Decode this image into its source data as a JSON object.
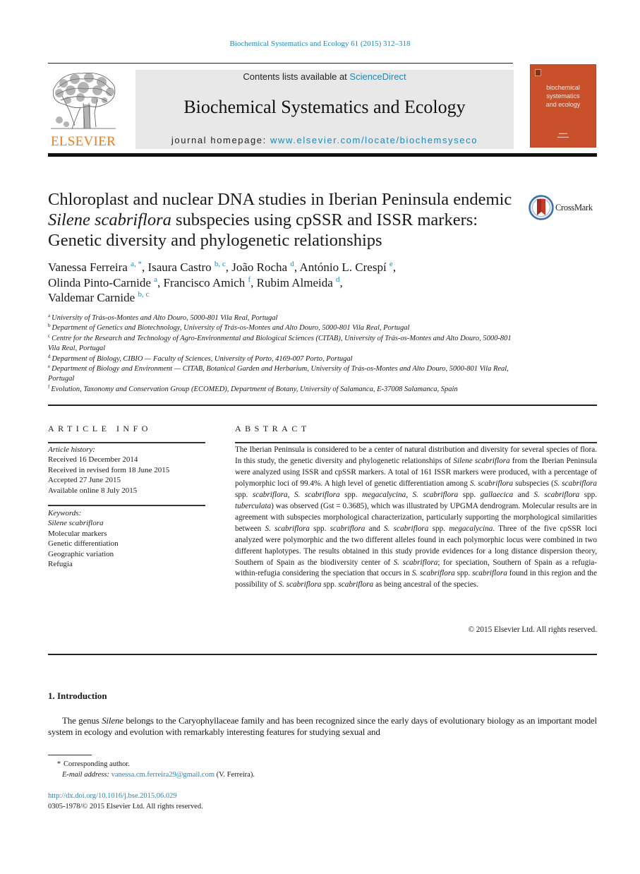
{
  "running_head": "Biochemical Systematics and Ecology 61 (2015) 312–318",
  "publisher": {
    "logo_word": "ELSEVIER",
    "logo_color": "#f07c1a"
  },
  "banner": {
    "contents_prefix": "Contents lists available at ",
    "contents_link": "ScienceDirect",
    "journal_title": "Biochemical Systematics and Ecology",
    "homepage_prefix": "journal homepage: ",
    "homepage_link": "www.elsevier.com/locate/biochemsyseco"
  },
  "cover": {
    "title_line1": "biochemical",
    "title_line2": "systematics",
    "title_line3": "and ecology",
    "color": "#c9502a"
  },
  "crossmark": {
    "label": "CrossMark"
  },
  "article": {
    "title_part1": "Chloroplast and nuclear DNA studies in Iberian Peninsula endemic ",
    "title_italic": "Silene scabriflora",
    "title_part2": " subspecies using cpSSR and ISSR markers: Genetic diversity and phylogenetic relationships"
  },
  "authors": [
    {
      "name": "Vanessa Ferreira",
      "sup": "a, *",
      "sep": ", "
    },
    {
      "name": "Isaura Castro",
      "sup": "b, c",
      "sep": ", "
    },
    {
      "name": "João Rocha",
      "sup": "d",
      "sep": ", "
    },
    {
      "name": "António L. Crespí",
      "sup": "e",
      "sep": ","
    },
    {
      "name": "Olinda Pinto-Carnide",
      "sup": "a",
      "sep": ", "
    },
    {
      "name": "Francisco Amich",
      "sup": "f",
      "sep": ", "
    },
    {
      "name": "Rubim Almeida",
      "sup": "d",
      "sep": ","
    },
    {
      "name": "Valdemar Carnide",
      "sup": "b, c",
      "sep": ""
    }
  ],
  "affiliations": [
    {
      "key": "a",
      "text": "University of Trás-os-Montes and Alto Douro, 5000-801 Vila Real, Portugal"
    },
    {
      "key": "b",
      "text": "Department of Genetics and Biotechnology, University of Trás-os-Montes and Alto Douro, 5000-801 Vila Real, Portugal"
    },
    {
      "key": "c",
      "text": "Centre for the Research and Technology of Agro-Environmental and Biological Sciences (CITAB), University of Trás-os-Montes and Alto Douro, 5000-801 Vila Real, Portugal"
    },
    {
      "key": "d",
      "text": "Department of Biology, CIBIO — Faculty of Sciences, University of Porto, 4169-007 Porto, Portugal"
    },
    {
      "key": "e",
      "text": "Department of Biology and Environment — CITAB, Botanical Garden and Herbarium, University of Trás-os-Montes and Alto Douro, 5000-801 Vila Real, Portugal"
    },
    {
      "key": "f",
      "text": "Evolution, Taxonomy and Conservation Group (ECOMED), Department of Botany, University of Salamanca, E-37008 Salamanca, Spain"
    }
  ],
  "article_info": {
    "heading": "ARTICLE INFO",
    "history_label": "Article history:",
    "history": [
      "Received 16 December 2014",
      "Received in revised form 18 June 2015",
      "Accepted 27 June 2015",
      "Available online 8 July 2015"
    ],
    "keywords_label": "Keywords:",
    "keywords": [
      "Silene scabriflora",
      "Molecular markers",
      "Genetic differentiation",
      "Geographic variation",
      "Refugia"
    ]
  },
  "abstract": {
    "heading": "ABSTRACT",
    "segments": [
      {
        "t": "The Iberian Peninsula is considered to be a center of natural distribution and diversity for several species of flora. In this study, the genetic diversity and phylogenetic relationships of "
      },
      {
        "t": "Silene scabriflora",
        "i": true
      },
      {
        "t": " from the Iberian Peninsula were analyzed using ISSR and cpSSR markers. A total of 161 ISSR markers were produced, with a percentage of polymorphic loci of 99.4%. A high level of genetic differentiation among "
      },
      {
        "t": "S. scabriflora",
        "i": true
      },
      {
        "t": " subspecies ("
      },
      {
        "t": "S. scabriflora",
        "i": true
      },
      {
        "t": " spp. "
      },
      {
        "t": "scabriflora",
        "i": true
      },
      {
        "t": ", "
      },
      {
        "t": "S. scabriflora",
        "i": true
      },
      {
        "t": " spp. "
      },
      {
        "t": "megacalycina",
        "i": true
      },
      {
        "t": ", "
      },
      {
        "t": "S. scabriflora",
        "i": true
      },
      {
        "t": " spp. "
      },
      {
        "t": "gallaecica",
        "i": true
      },
      {
        "t": " and "
      },
      {
        "t": "S. scabriflora",
        "i": true
      },
      {
        "t": " spp. "
      },
      {
        "t": "tuberculata",
        "i": true
      },
      {
        "t": ") was observed (Gst = 0.3685), which was illustrated by UPGMA dendrogram. Molecular results are in agreement with subspecies morphological characterization, particularly supporting the morphological similarities between "
      },
      {
        "t": "S. scabriflora",
        "i": true
      },
      {
        "t": " spp. "
      },
      {
        "t": "scabriflora",
        "i": true
      },
      {
        "t": " and "
      },
      {
        "t": "S. scabriflora",
        "i": true
      },
      {
        "t": " spp. "
      },
      {
        "t": "megacalycina",
        "i": true
      },
      {
        "t": ". Three of the five cpSSR loci analyzed were polymorphic and the two different alleles found in each polymorphic locus were combined in two different haplotypes. The results obtained in this study provide evidences for a long distance dispersion theory, Southern of Spain as the biodiversity center of "
      },
      {
        "t": "S. scabriflora",
        "i": true
      },
      {
        "t": "; for speciation, Southern of Spain as a refugia-within-refugia considering the speciation that occurs in "
      },
      {
        "t": "S. scabriflora",
        "i": true
      },
      {
        "t": " spp. "
      },
      {
        "t": "scabriflora",
        "i": true
      },
      {
        "t": " found in this region and the possibility of "
      },
      {
        "t": "S. scabriflora",
        "i": true
      },
      {
        "t": " spp. "
      },
      {
        "t": "scabriflora",
        "i": true
      },
      {
        "t": " as being ancestral of the species."
      }
    ],
    "copyright": "© 2015 Elsevier Ltd. All rights reserved."
  },
  "introduction": {
    "heading": "1.  Introduction",
    "para_start": "The genus ",
    "para_italic": "Silene",
    "para_rest": " belongs to the Caryophyllaceae family and has been recognized since the early days of evolutionary biology as an important model system in ecology and evolution with remarkably interesting features for studying sexual and"
  },
  "footnotes": {
    "star": "*",
    "corresponding": "Corresponding author.",
    "email_label": "E-mail address:",
    "email": "vanessa.cm.ferreira29@gmail.com",
    "email_owner": " (V. Ferreira).",
    "doi": "http://dx.doi.org/10.1016/j.bse.2015.06.029",
    "issn": "0305-1978/© 2015 Elsevier Ltd. All rights reserved."
  },
  "colors": {
    "link": "#1e88b8",
    "banner_bg": "#e8e8e8"
  }
}
